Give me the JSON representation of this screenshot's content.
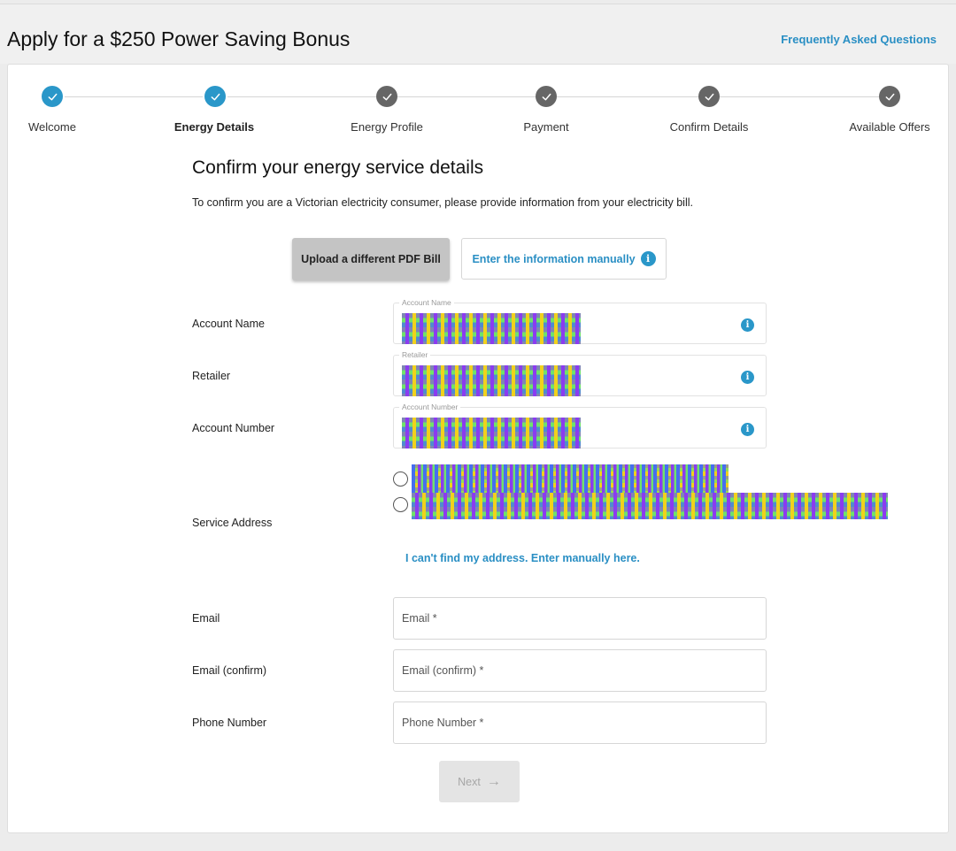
{
  "header": {
    "title": "Apply for a $250 Power Saving Bonus",
    "faq_link": "Frequently Asked Questions"
  },
  "stepper": {
    "steps": [
      {
        "label": "Welcome",
        "state": "completed"
      },
      {
        "label": "Energy Details",
        "state": "current"
      },
      {
        "label": "Energy Profile",
        "state": "completed"
      },
      {
        "label": "Payment",
        "state": "completed"
      },
      {
        "label": "Confirm Details",
        "state": "completed"
      },
      {
        "label": "Available Offers",
        "state": "completed"
      }
    ]
  },
  "form": {
    "title": "Confirm your energy service details",
    "subtitle": "To confirm you are a Victorian electricity consumer, please provide information from your electricity bill.",
    "upload_button": "Upload a different PDF Bill",
    "manual_button": "Enter the information manually",
    "info_glyph": "i",
    "fields": {
      "account_name": {
        "label": "Account Name",
        "float_label": "Account Name",
        "value": "[redacted]"
      },
      "retailer": {
        "label": "Retailer",
        "float_label": "Retailer",
        "value": "[redacted]"
      },
      "account_number": {
        "label": "Account Number",
        "float_label": "Account Number",
        "value": "[redacted]"
      }
    },
    "service_address": {
      "label": "Service Address",
      "options": [
        "[redacted]",
        "[redacted]"
      ],
      "cant_find_link": "I can't find my address. Enter manually here."
    },
    "email": {
      "label": "Email",
      "placeholder": "Email *"
    },
    "email_confirm": {
      "label": "Email (confirm)",
      "placeholder": "Email (confirm) *"
    },
    "phone": {
      "label": "Phone Number",
      "placeholder": "Phone Number *"
    },
    "next_button": "Next",
    "next_arrow": "→"
  },
  "colors": {
    "accent": "#2a97c9",
    "link": "#2a8fc4",
    "step_done": "#666666",
    "button_disabled": "#e4e4e4"
  },
  "icons": {
    "step_check": "check-icon",
    "info": "info-icon",
    "next_arrow": "arrow-right-icon"
  }
}
